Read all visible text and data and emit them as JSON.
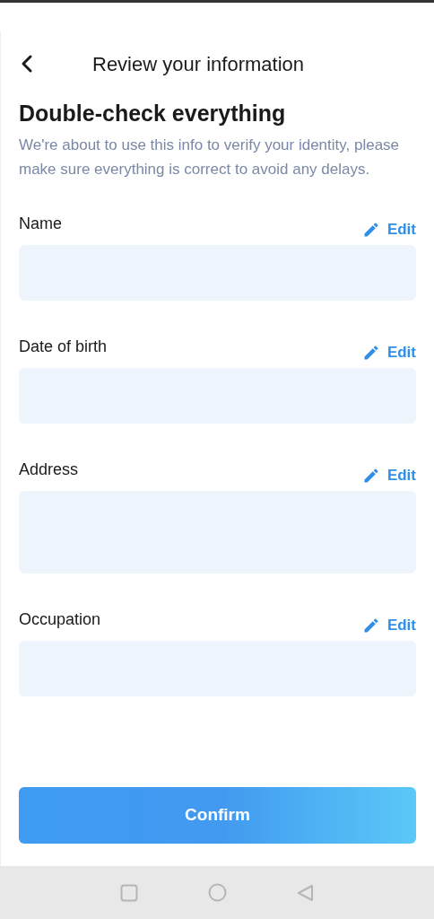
{
  "header": {
    "title": "Review your information"
  },
  "heading": "Double-check everything",
  "description": "We're about to use this info to verify your identity, please make sure everything is correct to avoid any delays.",
  "fields": [
    {
      "label": "Name",
      "kind": "single",
      "edit": "Edit"
    },
    {
      "label": "Date of birth",
      "kind": "single",
      "edit": "Edit"
    },
    {
      "label": "Address",
      "kind": "multiline",
      "edit": "Edit"
    },
    {
      "label": "Occupation",
      "kind": "single",
      "edit": "Edit"
    }
  ],
  "confirm_button": "Confirm"
}
